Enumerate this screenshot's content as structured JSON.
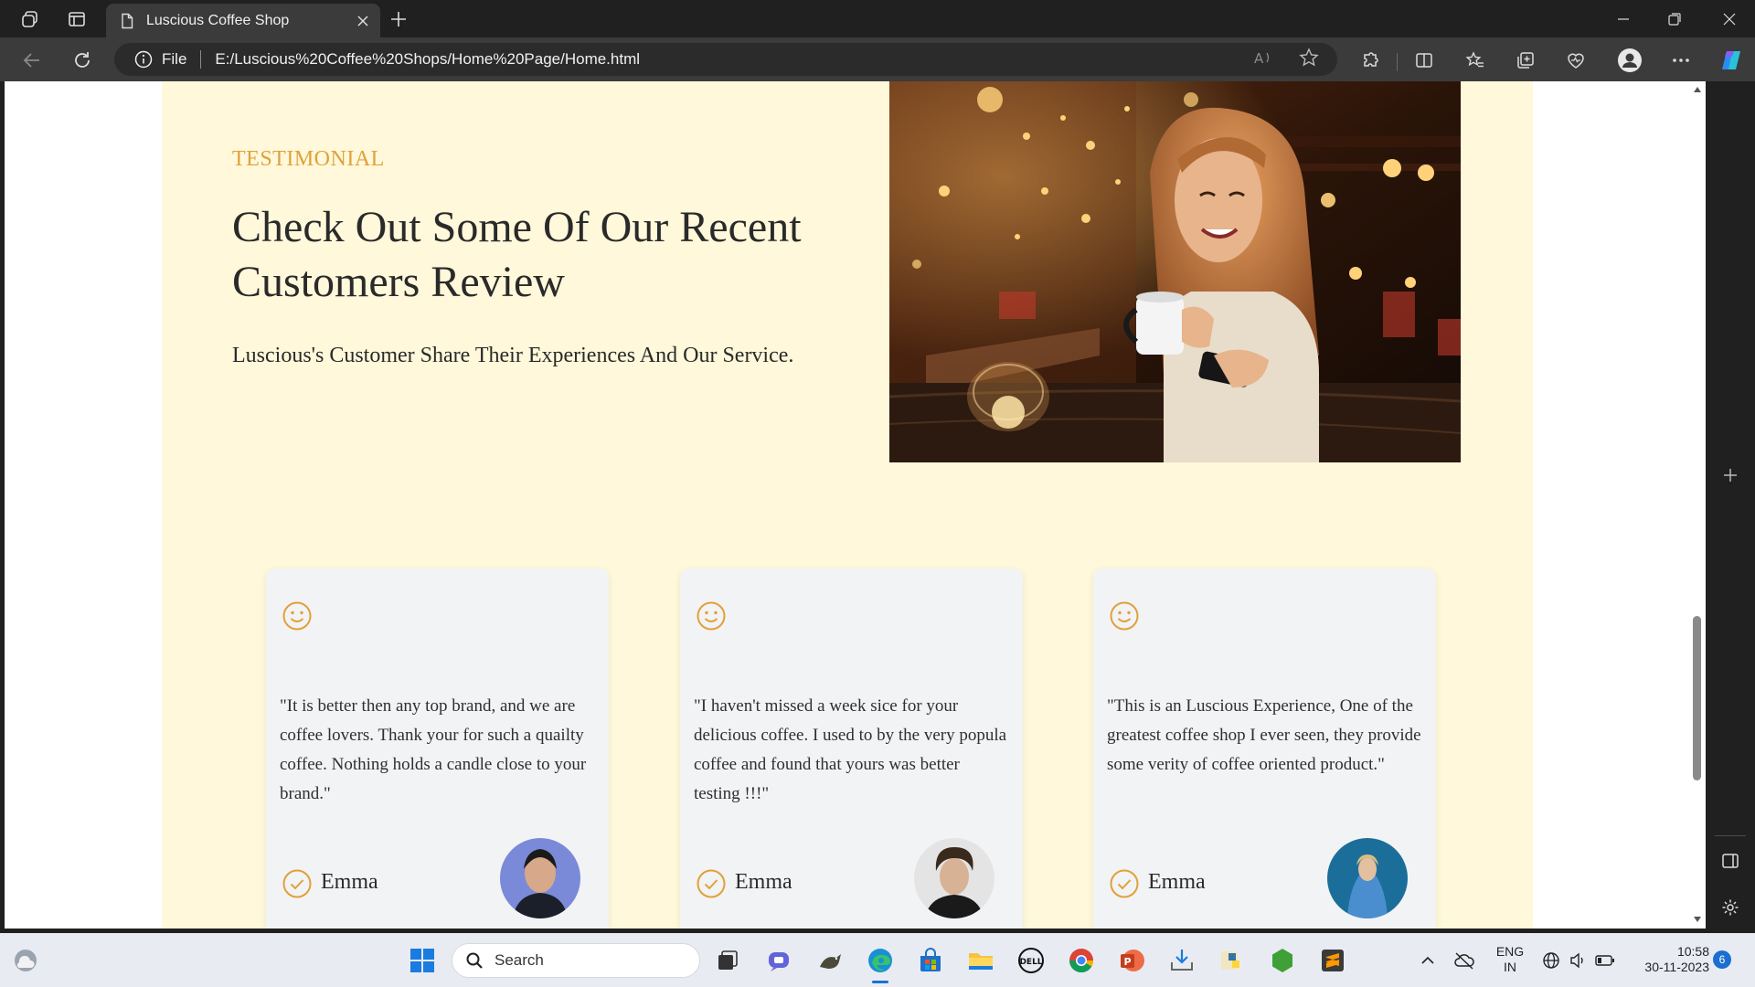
{
  "browser": {
    "tab_title": "Luscious Coffee Shop",
    "scheme_label": "File",
    "url": "E:/Luscious%20Coffee%20Shops/Home%20Page/Home.html"
  },
  "page": {
    "eyebrow": "TESTIMONIAL",
    "heading": "Check Out Some Of Our Recent Customers Review",
    "subtext": "Luscious's Customer Share Their Experiences And Our Service.",
    "accent_color": "#e0a13a",
    "section_bg": "#fff8da",
    "testimonials": [
      {
        "quote": "\"It is better then any top brand, and we are coffee lovers. Thank your for such a quailty coffee. Nothing holds a candle close to your brand.\"",
        "name": "Emma"
      },
      {
        "quote": "\"I haven't missed a week sice for your delicious coffee. I used to by the very popula coffee and found that yours was better testing !!!\"",
        "name": "Emma"
      },
      {
        "quote": "\"This is an Luscious Experience, One of the greatest coffee shop I ever seen, they provide some verity of coffee oriented product.\"",
        "name": "Emma"
      }
    ]
  },
  "taskbar": {
    "search_label": "Search",
    "lang_line1": "ENG",
    "lang_line2": "IN",
    "time": "10:58",
    "date": "30-11-2023",
    "notification_count": "6"
  }
}
